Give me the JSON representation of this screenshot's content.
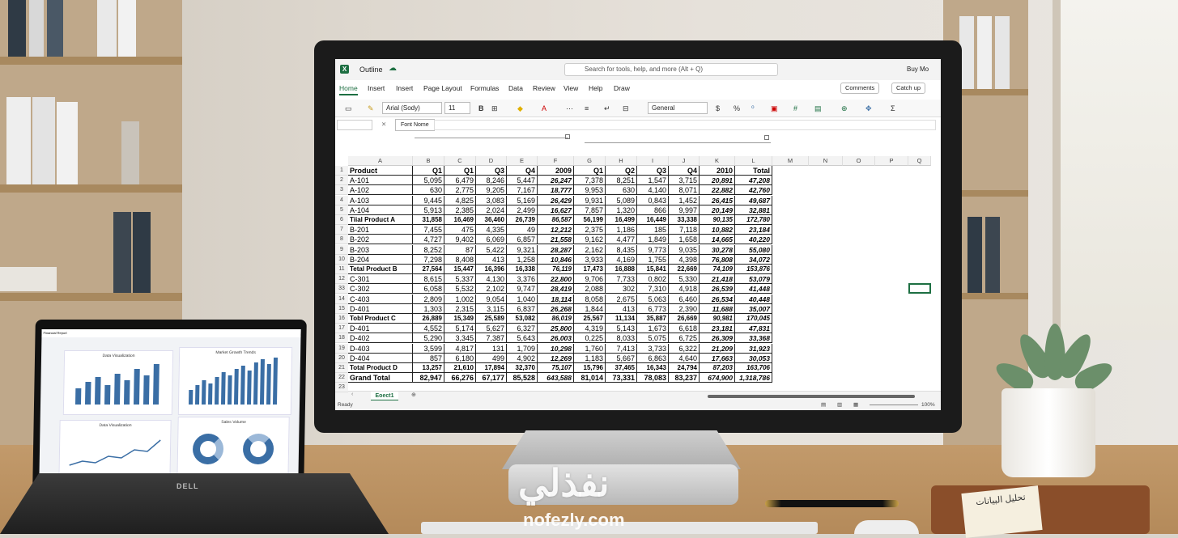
{
  "app": {
    "title": "Outline",
    "search_placeholder": "Search for tools, help, and more (Alt + Q)",
    "buy_label": "Buy Mo"
  },
  "tabs": [
    "Home",
    "Insert",
    "Insert",
    "Page Layout",
    "Formulas",
    "Data",
    "Review",
    "View",
    "Help",
    "Draw"
  ],
  "tab_buttons": {
    "comments": "Comments",
    "catchup": "Catch up"
  },
  "ribbon": {
    "font_name": "Arial (Sody)",
    "font_size": "11",
    "number_format": "General",
    "bold": "B"
  },
  "formula_bar": {
    "tooltip": "Font Nome"
  },
  "columns": [
    "A",
    "B",
    "C",
    "D",
    "E",
    "F",
    "G",
    "H",
    "I",
    "J",
    "K",
    "L",
    "M",
    "N",
    "O",
    "P",
    "Q"
  ],
  "grid": [
    [
      "Product",
      "Q1",
      "Q1",
      "Q3",
      "Q4",
      "2009",
      "Q1",
      "Q2",
      "Q3",
      "Q4",
      "2010",
      "Total"
    ],
    [
      "A-101",
      "5,095",
      "6,479",
      "8,246",
      "5,447",
      "26,247",
      "7,378",
      "8,251",
      "1,547",
      "3,715",
      "20,891",
      "47,208"
    ],
    [
      "A-102",
      "630",
      "2,775",
      "9,205",
      "7,167",
      "18,777",
      "9,953",
      "630",
      "4,140",
      "8,071",
      "22,882",
      "42,760"
    ],
    [
      "A-103",
      "9,445",
      "4,825",
      "3,083",
      "5,169",
      "26,429",
      "9,931",
      "5,089",
      "0,843",
      "1,452",
      "26,415",
      "49,687"
    ],
    [
      "A-104",
      "5,913",
      "2,385",
      "2,024",
      "2,499",
      "16,627",
      "7,857",
      "1,320",
      "866",
      "9,997",
      "20,149",
      "32,881"
    ],
    [
      "Tiial Product A",
      "31,858",
      "16,469",
      "36,460",
      "26,739",
      "86,587",
      "56,199",
      "16,499",
      "16,449",
      "33,338",
      "90,135",
      "172,780"
    ],
    [
      "B-201",
      "7,455",
      "475",
      "4,335",
      "49",
      "12,212",
      "2,375",
      "1,186",
      "185",
      "7,118",
      "10,882",
      "23,184"
    ],
    [
      "B-202",
      "4,727",
      "9,402",
      "6,069",
      "6,857",
      "21,558",
      "9,162",
      "4,477",
      "1,849",
      "1,658",
      "14,665",
      "40,220"
    ],
    [
      "B-203",
      "8,252",
      "87",
      "5,422",
      "9,321",
      "28,287",
      "2,162",
      "8,435",
      "9,773",
      "9,035",
      "30,278",
      "55,080"
    ],
    [
      "B-204",
      "7,298",
      "8,408",
      "413",
      "1,258",
      "10,846",
      "3,933",
      "4,169",
      "1,755",
      "4,398",
      "76,808",
      "34,072"
    ],
    [
      "Tetal Product B",
      "27,564",
      "15,447",
      "16,396",
      "16,338",
      "76,119",
      "17,473",
      "16,888",
      "15,841",
      "22,669",
      "74,109",
      "153,876"
    ],
    [
      "C-301",
      "8,615",
      "5,337",
      "4,130",
      "3,376",
      "22,800",
      "9,706",
      "7,733",
      "0,802",
      "5,330",
      "21,418",
      "53,079"
    ],
    [
      "C-302",
      "6,058",
      "5,532",
      "2,102",
      "9,747",
      "28,419",
      "2,088",
      "302",
      "7,310",
      "4,918",
      "26,539",
      "41,448"
    ],
    [
      "C-403",
      "2,809",
      "1,002",
      "9,054",
      "1,040",
      "18,114",
      "8,058",
      "2,675",
      "5,063",
      "6,460",
      "26,534",
      "40,448"
    ],
    [
      "D-401",
      "1,303",
      "2,315",
      "3,115",
      "6,837",
      "26,268",
      "1,844",
      "413",
      "6,773",
      "2,390",
      "11,688",
      "35,007"
    ],
    [
      "Tobl Product C",
      "26,889",
      "15,349",
      "25,589",
      "53,082",
      "86,019",
      "25,567",
      "11,134",
      "35,887",
      "26,669",
      "90,981",
      "170,045"
    ],
    [
      "D-401",
      "4,552",
      "5,174",
      "5,627",
      "6,327",
      "25,800",
      "4,319",
      "5,143",
      "1,673",
      "6,618",
      "23,181",
      "47,831"
    ],
    [
      "D-402",
      "5,290",
      "3,345",
      "7,387",
      "5,643",
      "26,003",
      "0,225",
      "8,033",
      "5,075",
      "6,725",
      "26,309",
      "33,368"
    ],
    [
      "D-403",
      "3,599",
      "4,817",
      "131",
      "1,709",
      "10,298",
      "1,760",
      "7,413",
      "3,733",
      "6,322",
      "21,209",
      "31,923"
    ],
    [
      "D-404",
      "857",
      "6,180",
      "499",
      "4,902",
      "12,269",
      "1,183",
      "5,667",
      "6,863",
      "4,640",
      "17,663",
      "30,053"
    ],
    [
      "Total Product D",
      "13,257",
      "21,610",
      "17,894",
      "32,370",
      "75,107",
      "15,796",
      "37,465",
      "16,343",
      "24,794",
      "87,203",
      "163,706"
    ],
    [
      "Grand Total",
      "82,947",
      "66,276",
      "67,177",
      "85,528",
      "643,588",
      "81,014",
      "73,331",
      "78,083",
      "83,237",
      "674,900",
      "1,318,786"
    ]
  ],
  "row_numbers": [
    "1",
    "2",
    "3",
    "4",
    "5",
    "6",
    "7",
    "8",
    "9",
    "10",
    "11",
    "12",
    "33",
    "14",
    "15",
    "16",
    "17",
    "18",
    "19",
    "20",
    "21",
    "22",
    "23"
  ],
  "sheet": {
    "name": "Eoect1",
    "status": "Ready",
    "zoom": "100%"
  },
  "laptop": {
    "brand": "DELL",
    "app_title": "Financial Report",
    "panels": [
      "Data Visualization",
      "Market Growth Trends",
      "Data Visualization",
      "Sales Volume"
    ]
  },
  "notebook_text": "تحليل البيانات",
  "watermark": {
    "arabic": "نفذلي",
    "latin": "nofezly.com"
  }
}
